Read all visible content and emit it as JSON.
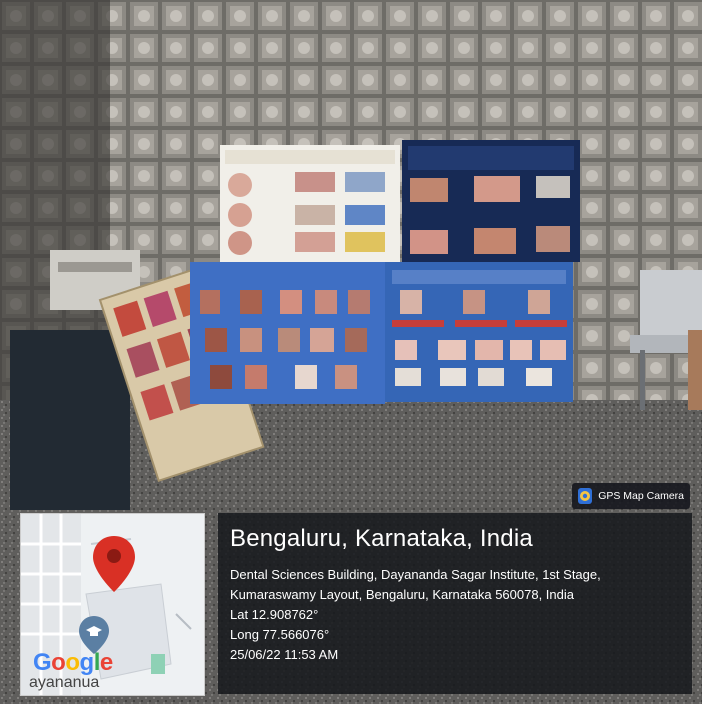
{
  "badge": {
    "label": "GPS Map Camera"
  },
  "location": {
    "place": "Bengaluru, Karnataka, India",
    "address_line_1": "Dental Sciences Building, Dayananda Sagar Institute, 1st Stage,",
    "address_line_2": "Kumaraswamy Layout, Bengaluru, Karnataka 560078, India",
    "lat": "Lat 12.908762°",
    "long": "Long 77.566076°",
    "timestamp": "25/06/22 11:53 AM"
  },
  "map": {
    "brand": "Google",
    "locality_fragment": "ayananua"
  },
  "colors": {
    "panel_bg": "#16181c",
    "poster_blue": "#3f6fc4",
    "poster_navy": "#172a55",
    "pin_red": "#d93025"
  }
}
